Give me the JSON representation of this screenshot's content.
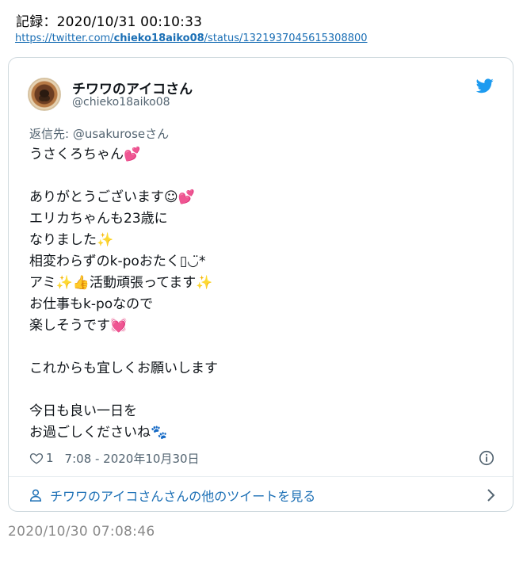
{
  "record": {
    "label": "記録：2020/10/31 00:10:33"
  },
  "source": {
    "prefix": "https://twitter.com/",
    "user": "chieko18aiko08",
    "suffix": "/status/1321937045615308800"
  },
  "tweet": {
    "display_name": "チワワのアイコさん",
    "handle": "@chieko18aiko08",
    "reply_to": "返信先: @usakuroseさん",
    "lines": [
      "うさくろちゃん💕",
      "",
      "ありがとうございます☺💕",
      "エリカちゃんも23歳に",
      "なりました✨",
      "相変わらずのk-poおたく▯◡̈*",
      "アミ✨👍活動頑張ってます✨",
      "お仕事もk-poなので",
      "楽しそうです💓",
      "",
      "これからも宜しくお願いします",
      "",
      "今日も良い一日を",
      "お過ごしくださいね🐾"
    ],
    "like_count": "1",
    "timestamp": "7:08 - 2020年10月30日",
    "more_link": "チワワのアイコさんさんの他のツイートを見る"
  },
  "footer": {
    "saved_time": "2020/10/30 07:08:46"
  },
  "colors": {
    "link": "#1b6fb5",
    "twitter_blue": "#1d9bf0",
    "muted": "#536471",
    "border": "#cfd9de"
  }
}
